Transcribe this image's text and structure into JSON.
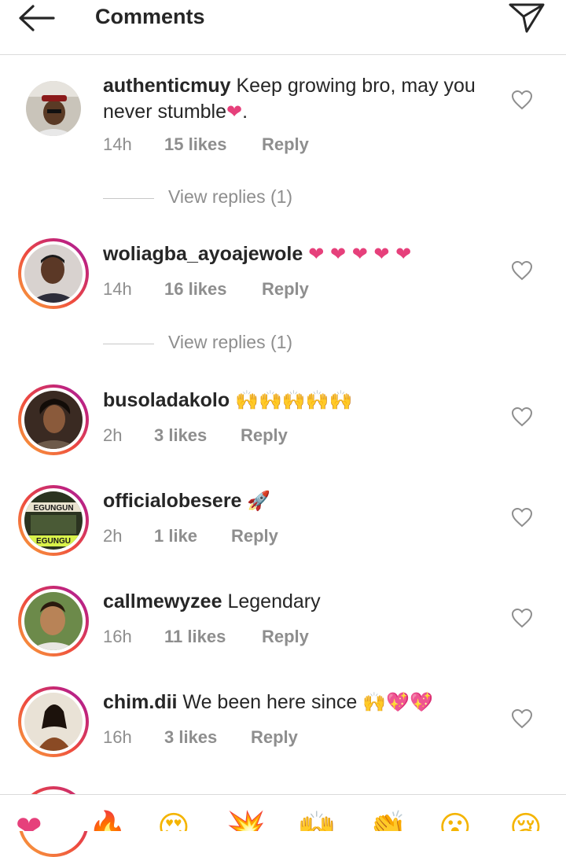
{
  "header": {
    "title": "Comments",
    "back_icon": "arrow-left-icon",
    "send_icon": "paper-plane-icon"
  },
  "comments": [
    {
      "username": "authenticmuy",
      "text": "Keep growing bro, may you never stumble",
      "emoji": "❤",
      "trail": ".",
      "time": "14h",
      "likes": "15 likes",
      "reply": "Reply"
    },
    {
      "username": "woliagba_ayoajewole",
      "text": "",
      "emoji": "❤ ❤ ❤ ❤ ❤",
      "trail": "",
      "time": "14h",
      "likes": "16 likes",
      "reply": "Reply"
    },
    {
      "username": "busoladakolo",
      "text": "",
      "emoji": "🙌🙌🙌🙌🙌",
      "trail": "",
      "time": "2h",
      "likes": "3 likes",
      "reply": "Reply"
    },
    {
      "username": "officialobesere",
      "text": "",
      "emoji": "🚀",
      "trail": "",
      "time": "2h",
      "likes": "1 like",
      "reply": "Reply"
    },
    {
      "username": "callmewyzee",
      "text": "Legendary",
      "emoji": "",
      "trail": "",
      "time": "16h",
      "likes": "11 likes",
      "reply": "Reply"
    },
    {
      "username": "chim.dii",
      "text": "We been here since",
      "emoji": "🙌💖💖",
      "trail": "",
      "time": "16h",
      "likes": "3 likes",
      "reply": "Reply"
    }
  ],
  "view_replies": [
    {
      "label": "View replies (1)"
    },
    {
      "label": "View replies (1)"
    }
  ],
  "avatar_texts": {
    "officialobesere_top": "EGUNGUN",
    "officialobesere_bottom": "EGUNGU"
  },
  "reaction_bar": {
    "items": [
      "❤",
      "🔥",
      "😍",
      "💥",
      "🙌",
      "👏",
      "😮",
      "😢"
    ],
    "icons": [
      "heart",
      "fire",
      "heart-eyes",
      "boom",
      "raised-hands",
      "clapping",
      "surprised",
      "sad"
    ]
  },
  "colors": {
    "heart": "#e6407b",
    "text_primary": "#262626",
    "text_secondary": "#8e8e8e",
    "story_ring": "#ee4a3f"
  }
}
